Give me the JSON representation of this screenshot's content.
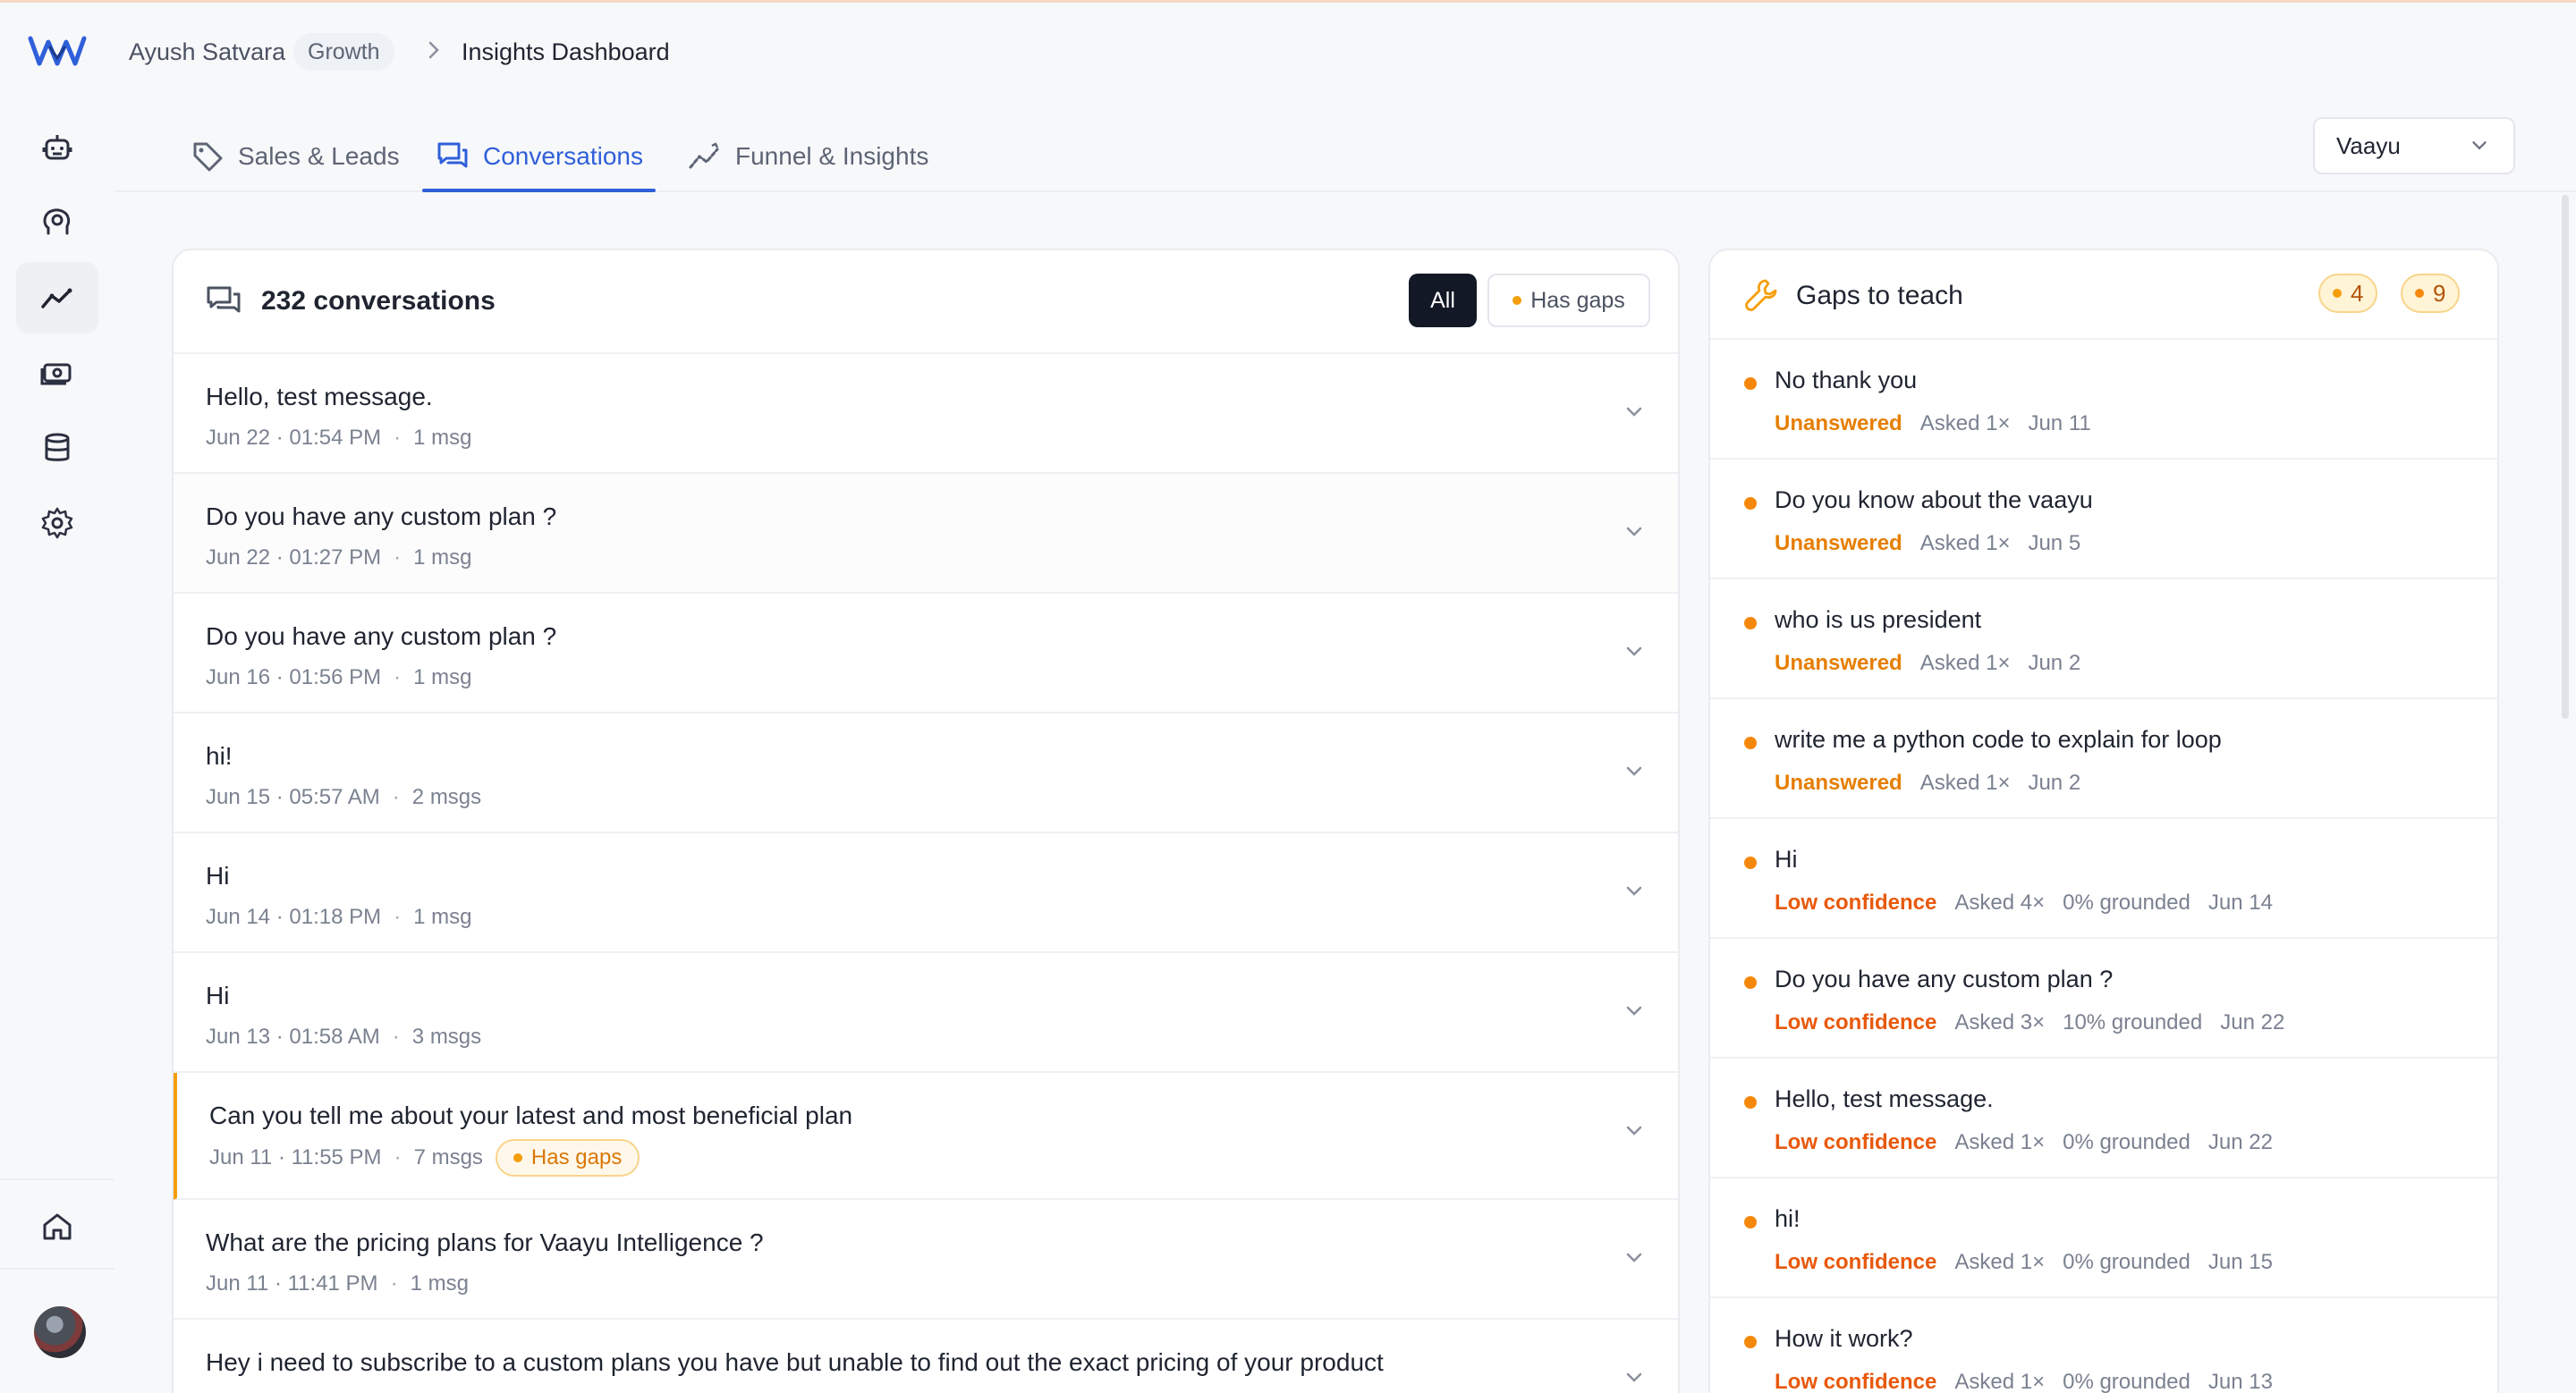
{
  "breadcrumb": {
    "user": "Ayush Satvara",
    "plan": "Growth",
    "page": "Insights Dashboard"
  },
  "nav": {
    "items": [
      {
        "icon": "robot-icon"
      },
      {
        "icon": "brain-icon"
      },
      {
        "icon": "analytics-icon",
        "active": true
      },
      {
        "icon": "cash-icon"
      },
      {
        "icon": "database-icon"
      },
      {
        "icon": "gear-icon"
      }
    ],
    "home_icon": "home-icon"
  },
  "tabs": [
    {
      "label": "Sales & Leads",
      "icon": "tag-icon"
    },
    {
      "label": "Conversations",
      "icon": "chat-icon",
      "active": true
    },
    {
      "label": "Funnel & Insights",
      "icon": "trend-icon"
    }
  ],
  "bot_selector": {
    "value": "Vaayu"
  },
  "conversations": {
    "count_label": "232 conversations",
    "filter_all": "All",
    "filter_gaps": "Has gaps",
    "items": [
      {
        "title": "Hello, test message.",
        "time": "Jun 22 · 01:54 PM",
        "msgs": "1 msg",
        "gap": ""
      },
      {
        "title": "Do you have any custom plan ?",
        "time": "Jun 22 · 01:27 PM",
        "msgs": "1 msg",
        "gap": ""
      },
      {
        "title": "Do you have any custom plan ?",
        "time": "Jun 16 · 01:56 PM",
        "msgs": "1 msg",
        "gap": ""
      },
      {
        "title": "hi!",
        "time": "Jun 15 · 05:57 AM",
        "msgs": "2 msgs",
        "gap": ""
      },
      {
        "title": "Hi",
        "time": "Jun 14 · 01:18 PM",
        "msgs": "1 msg",
        "gap": ""
      },
      {
        "title": "Hi",
        "time": "Jun 13 · 01:58 AM",
        "msgs": "3 msgs",
        "gap": ""
      },
      {
        "title": "Can you tell me about your latest and most beneficial plan",
        "time": "Jun 11 · 11:55 PM",
        "msgs": "7 msgs",
        "gap": "Has gaps"
      },
      {
        "title": "What are the pricing plans for Vaayu Intelligence ?",
        "time": "Jun 11 · 11:41 PM",
        "msgs": "1 msg",
        "gap": ""
      },
      {
        "title": "Hey i need to subscribe to a custom plans you have but unable to find out the exact pricing of your product",
        "time": "",
        "msgs": "",
        "gap": ""
      }
    ]
  },
  "gaps": {
    "title": "Gaps to teach",
    "count_a": "4",
    "count_b": "9",
    "items": [
      {
        "q": "No thank you",
        "status": "Unanswered",
        "asked": "Asked 1×",
        "grounded": "",
        "date": "Jun 11"
      },
      {
        "q": "Do you know about the vaayu",
        "status": "Unanswered",
        "asked": "Asked 1×",
        "grounded": "",
        "date": "Jun 5"
      },
      {
        "q": "who is us president",
        "status": "Unanswered",
        "asked": "Asked 1×",
        "grounded": "",
        "date": "Jun 2"
      },
      {
        "q": "write me a python code to explain for loop",
        "status": "Unanswered",
        "asked": "Asked 1×",
        "grounded": "",
        "date": "Jun 2"
      },
      {
        "q": "Hi",
        "status": "Low confidence",
        "asked": "Asked 4×",
        "grounded": "0% grounded",
        "date": "Jun 14"
      },
      {
        "q": "Do you have any custom plan ?",
        "status": "Low confidence",
        "asked": "Asked 3×",
        "grounded": "10% grounded",
        "date": "Jun 22"
      },
      {
        "q": "Hello, test message.",
        "status": "Low confidence",
        "asked": "Asked 1×",
        "grounded": "0% grounded",
        "date": "Jun 22"
      },
      {
        "q": "hi!",
        "status": "Low confidence",
        "asked": "Asked 1×",
        "grounded": "0% grounded",
        "date": "Jun 15"
      },
      {
        "q": "How it work?",
        "status": "Low confidence",
        "asked": "Asked 1×",
        "grounded": "0% grounded",
        "date": "Jun 13"
      }
    ]
  },
  "colors": {
    "accent": "#2f5fd9",
    "warning": "#f59e0b",
    "dark": "#121826"
  }
}
